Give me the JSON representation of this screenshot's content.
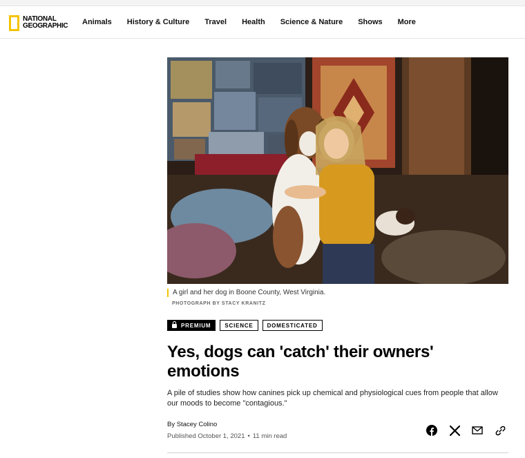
{
  "brand": {
    "logo_line1": "NATIONAL",
    "logo_line2": "GEOGRAPHIC",
    "accent_color": "#f5c400"
  },
  "nav": {
    "items": [
      "Animals",
      "History & Culture",
      "Travel",
      "Health",
      "Science & Nature",
      "Shows",
      "More"
    ]
  },
  "hero": {
    "caption": "A girl and her dog in Boone County, West Virginia.",
    "credit": "PHOTOGRAPH BY STACY KRANITZ"
  },
  "tags": {
    "premium": "PREMIUM",
    "science": "SCIENCE",
    "domesticated": "DOMESTICATED"
  },
  "article": {
    "headline": "Yes, dogs can 'catch' their owners' emotions",
    "dek": "A pile of studies show how canines pick up chemical and physiological cues from people that allow our moods to become \"contagious.\"",
    "byline": "By Stacey Colino",
    "published": "Published October 1, 2021",
    "read_time": "11 min read"
  },
  "share": {
    "icons": [
      "facebook-icon",
      "x-icon",
      "mail-icon",
      "link-icon"
    ]
  }
}
